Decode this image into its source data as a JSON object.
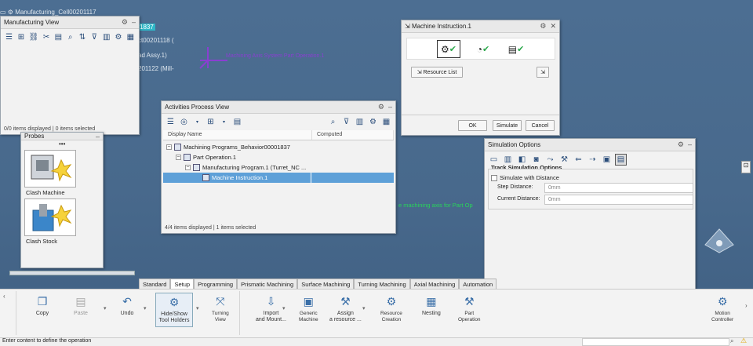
{
  "background_tree": {
    "root": "Manufacturing_Cell00201117",
    "lines": [
      "1837",
      "ct00201118 (",
      "ad Assy.1)",
      "201122 (Mill-"
    ]
  },
  "viewport": {
    "axis_text": "e machining axis for Part Op",
    "axis_text_top": "Machining Axis System Part Operation.1"
  },
  "manufacturing_view": {
    "title": "Manufacturing View",
    "status": "0/0 items displayed | 0 items selected"
  },
  "probes": {
    "title": "Probes",
    "items": [
      {
        "label": "Clash Machine"
      },
      {
        "label": "Clash Stock"
      }
    ]
  },
  "activities_view": {
    "title": "Activities Process View",
    "columns": [
      "Display Name",
      "Computed"
    ],
    "rows": [
      {
        "label": "Machining Programs_Behavior00001837",
        "selected": false
      },
      {
        "label": "Part Operation.1",
        "selected": false
      },
      {
        "label": "Manufacturing Program.1 (Turret_NC ...",
        "selected": false
      },
      {
        "label": "Machine Instruction.1",
        "selected": true
      }
    ],
    "status": "4/4 items displayed | 1 items selected"
  },
  "machine_instruction": {
    "title": "Machine Instruction.1",
    "resource_list": "Resource List",
    "ok": "OK",
    "simulate": "Simulate",
    "cancel": "Cancel"
  },
  "simulation_options": {
    "title": "Simulation Options",
    "section": "Track Simulation Options",
    "checkbox_label": "Simulate with Distance",
    "step_label": "Step Distance:",
    "step_value": "0mm",
    "current_label": "Current Distance:",
    "current_value": "0mm"
  },
  "ribbon": {
    "tabs": [
      "Standard",
      "Setup",
      "Programming",
      "Prismatic Machining",
      "Surface Machining",
      "Turning Machining",
      "Axial Machining",
      "Automation"
    ],
    "active_tab": "Setup",
    "buttons": [
      {
        "label": "Copy",
        "icon": "copy-icon"
      },
      {
        "label": "Paste",
        "icon": "paste-icon"
      },
      {
        "label": "Undo",
        "icon": "undo-icon"
      },
      {
        "label": "Hide/Show\nTool Holders",
        "icon": "tool-holder-icon"
      },
      {
        "label": "Turning\nView",
        "icon": "turning-view-icon"
      },
      {
        "label": "Import\nand Mount...",
        "icon": "import-icon"
      },
      {
        "label": "Generic\nMachine",
        "icon": "generic-machine-icon"
      },
      {
        "label": "Assign\na resource ...",
        "icon": "assign-resource-icon"
      },
      {
        "label": "Resource\nCreation",
        "icon": "resource-creation-icon"
      },
      {
        "label": "Nesting",
        "icon": "nesting-icon"
      },
      {
        "label": "Part\nOperation",
        "icon": "part-operation-icon"
      },
      {
        "label": "Motion\nController",
        "icon": "motion-controller-icon"
      }
    ]
  },
  "status_bar": {
    "prompt": "Enter content to define the operation"
  },
  "colors": {
    "background": "#48698c",
    "selection": "#5ea0d8",
    "check_green": "#2aa84a",
    "axis_purple": "#8a3fd1"
  }
}
